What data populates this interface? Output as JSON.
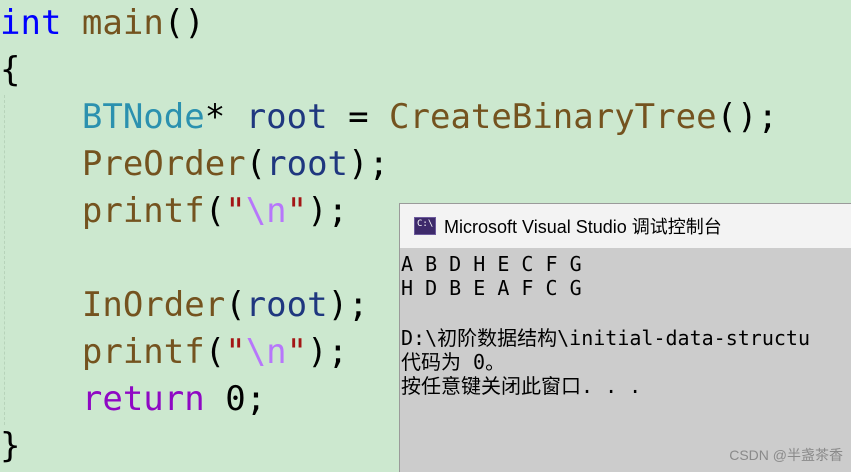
{
  "editor": {
    "lines": {
      "l1": {
        "kw": "int",
        "func": "main",
        "rest": "()"
      },
      "l2": {
        "brace": "{"
      },
      "l3": {
        "type": "BTNode",
        "star": "*",
        "var": "root",
        "eq": "=",
        "func": "CreateBinaryTree",
        "rest": "();"
      },
      "l4": {
        "func": "PreOrder",
        "open": "(",
        "var": "root",
        "rest": ");"
      },
      "l5": {
        "func": "printf",
        "open": "(",
        "q1": "\"",
        "esc": "\\n",
        "q2": "\"",
        "rest": ");"
      },
      "l7": {
        "func": "InOrder",
        "open": "(",
        "var": "root",
        "rest": ");"
      },
      "l8": {
        "func": "printf",
        "open": "(",
        "q1": "\"",
        "esc": "\\n",
        "q2": "\"",
        "rest": ");"
      },
      "l9": {
        "kw": "return",
        "num": "0",
        "rest": ";"
      },
      "l10": {
        "brace": "}"
      }
    }
  },
  "console": {
    "title": "Microsoft Visual Studio 调试控制台",
    "icon": "console-app-icon",
    "icon_text": "C:\\",
    "output": [
      "A B D H E C F G",
      "H D B E A F C G",
      "",
      "D:\\初阶数据结构\\initial-data-structu",
      "代码为 0。",
      "按任意键关闭此窗口. . ."
    ]
  },
  "watermark": "CSDN @半盏茶香",
  "colors": {
    "background": "#cce8cf",
    "keyword": "#0000ff",
    "return_keyword": "#8f08c4",
    "type": "#2b91af",
    "function": "#74531f",
    "variable": "#1f377f",
    "string": "#a31515",
    "escape": "#b776fb"
  }
}
